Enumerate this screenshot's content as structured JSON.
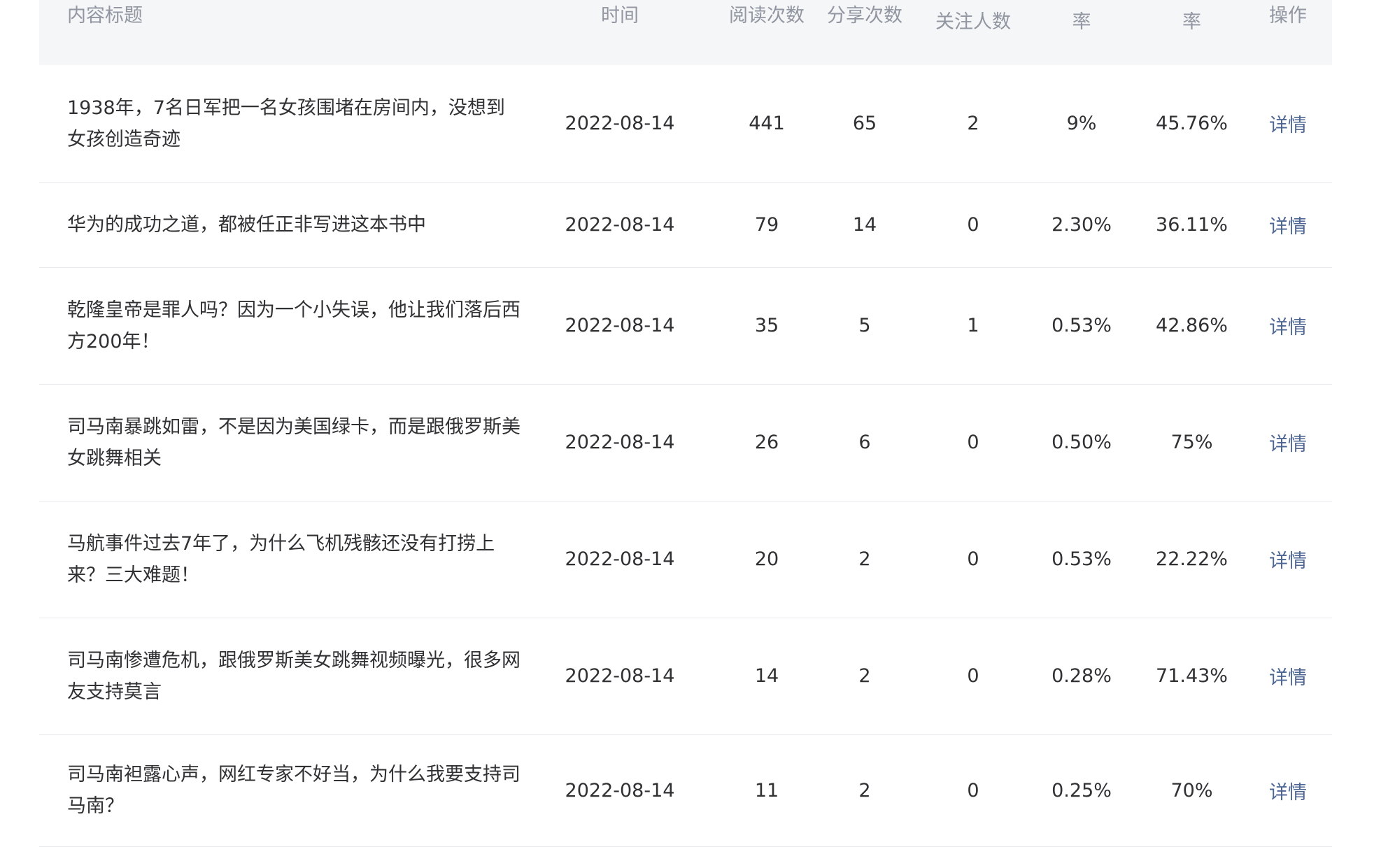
{
  "table": {
    "headers": {
      "title": "内容标题",
      "time": "时间",
      "reads": "阅读次数",
      "shares": "分享次数",
      "follow": "关注人数",
      "rate1": "率",
      "rate2": "率",
      "op": "操作"
    },
    "rows": [
      {
        "title": "1938年，7名日军把一名女孩围堵在房间内，没想到女孩创造奇迹",
        "time": "2022-08-14",
        "reads": "441",
        "shares": "65",
        "follow": "2",
        "rate1": "9%",
        "rate2": "45.76%",
        "op": "详情"
      },
      {
        "title": "华为的成功之道，都被任正非写进这本书中",
        "time": "2022-08-14",
        "reads": "79",
        "shares": "14",
        "follow": "0",
        "rate1": "2.30%",
        "rate2": "36.11%",
        "op": "详情"
      },
      {
        "title": "乾隆皇帝是罪人吗？因为一个小失误，他让我们落后西方200年！",
        "time": "2022-08-14",
        "reads": "35",
        "shares": "5",
        "follow": "1",
        "rate1": "0.53%",
        "rate2": "42.86%",
        "op": "详情"
      },
      {
        "title": "司马南暴跳如雷，不是因为美国绿卡，而是跟俄罗斯美女跳舞相关",
        "time": "2022-08-14",
        "reads": "26",
        "shares": "6",
        "follow": "0",
        "rate1": "0.50%",
        "rate2": "75%",
        "op": "详情"
      },
      {
        "title": "马航事件过去7年了，为什么飞机残骸还没有打捞上来？三大难题！",
        "time": "2022-08-14",
        "reads": "20",
        "shares": "2",
        "follow": "0",
        "rate1": "0.53%",
        "rate2": "22.22%",
        "op": "详情"
      },
      {
        "title": "司马南惨遭危机，跟俄罗斯美女跳舞视频曝光，很多网友支持莫言",
        "time": "2022-08-14",
        "reads": "14",
        "shares": "2",
        "follow": "0",
        "rate1": "0.28%",
        "rate2": "71.43%",
        "op": "详情"
      },
      {
        "title": "司马南袒露心声，网红专家不好当，为什么我要支持司马南？",
        "time": "2022-08-14",
        "reads": "11",
        "shares": "2",
        "follow": "0",
        "rate1": "0.25%",
        "rate2": "70%",
        "op": "详情"
      }
    ]
  }
}
